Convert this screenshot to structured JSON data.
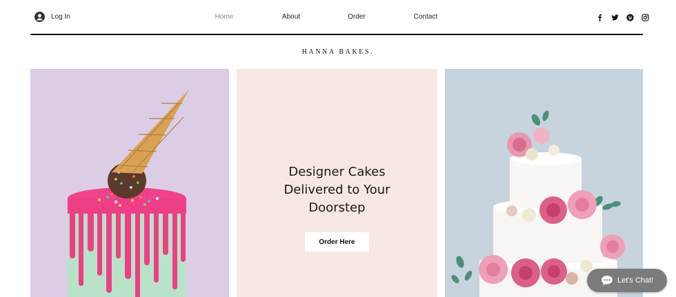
{
  "header": {
    "login_label": "Log In",
    "nav": [
      {
        "label": "Home",
        "active": true
      },
      {
        "label": "About",
        "active": false
      },
      {
        "label": "Order",
        "active": false
      },
      {
        "label": "Contact",
        "active": false
      }
    ],
    "social_icons": [
      "facebook-icon",
      "twitter-icon",
      "pinterest-icon",
      "instagram-icon"
    ]
  },
  "brand": {
    "name": "HANNA BAKES."
  },
  "hero": {
    "headline_lines": [
      "Designer Cakes",
      "Delivered to Your",
      "Doorstep"
    ],
    "cta_label": "Order Here"
  },
  "panels": {
    "left_bg": "#dbcde6",
    "center_bg": "#f7e7e2",
    "right_bg": "#c7d4dd"
  },
  "chat": {
    "label": "Let's Chat!"
  }
}
